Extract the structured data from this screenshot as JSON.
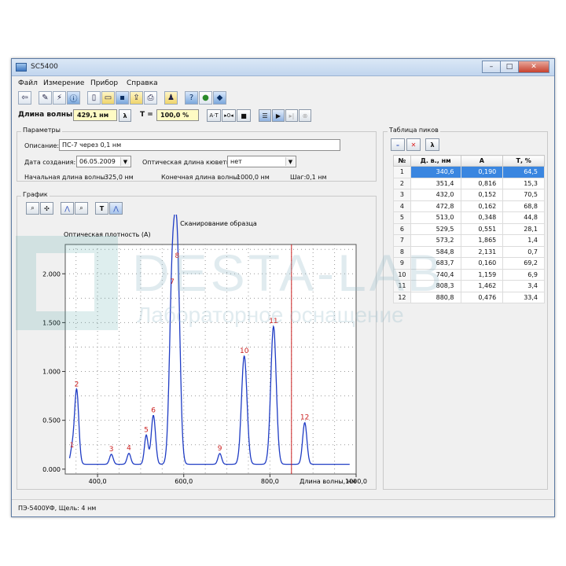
{
  "window": {
    "title": "SC5400",
    "controls": [
      "–",
      "□",
      "✕"
    ]
  },
  "menu": [
    "Файл",
    "Измерение",
    "Прибор",
    "Справка"
  ],
  "toolbar": {
    "buttons": [
      "exit-icon",
      "settings-icon",
      "calibrate-icon",
      "info-icon",
      "new-file-icon",
      "open-folder-icon",
      "save-icon",
      "save-as-icon",
      "print-icon",
      "export-icon",
      "help-icon",
      "globe-icon",
      "book-icon"
    ]
  },
  "wavelength_bar": {
    "wavelength_label": "Длина волны:",
    "wavelength_value": "429,1 нм",
    "lambda_button": "λ",
    "t_label": "T =",
    "t_value": "100,0 %",
    "at_button": "A·T",
    "zero_button": "▸0◂",
    "stop_button": "■"
  },
  "params": {
    "group_title": "Параметры",
    "description_label": "Описание:",
    "description_value": "ПС-7 через 0,1 нм",
    "date_label": "Дата создания:",
    "date_value": "06.05.2009",
    "cuvette_label": "Оптическая длина кюветы:",
    "cuvette_value": "нет",
    "start_label": "Начальная длина волны:",
    "start_value": "325,0 нм",
    "end_label": "Конечная длина волны:",
    "end_value": "1000,0 нм",
    "step_label": "Шаг:",
    "step_value": "0,1 нм"
  },
  "graph": {
    "group_title": "График",
    "tool_t": "T",
    "tool_lambda": "λ"
  },
  "chart_data": {
    "type": "line",
    "title": "Сканирование образца",
    "ylabel": "Оптическая плотность (А)",
    "xlabel": "Длина волны, нм",
    "xlim": [
      325,
      1000
    ],
    "ylim": [
      -0.05,
      2.3
    ],
    "xticks": [
      400,
      600,
      800,
      1000
    ],
    "xtick_labels": [
      "400,0",
      "600,0",
      "800,0",
      "1000,0"
    ],
    "yticks": [
      0,
      0.5,
      1.0,
      1.5,
      2.0
    ],
    "ytick_labels": [
      "0.000",
      "0.500",
      "1.000",
      "1.500",
      "2.000"
    ],
    "grid": true,
    "cursor_x": 850,
    "color": "#1f3cc4",
    "cursor_color": "#cc2222",
    "baseline": 0.05,
    "peaks": [
      {
        "n": 1,
        "x": 340.6,
        "y": 0.19
      },
      {
        "n": 2,
        "x": 351.4,
        "y": 0.816
      },
      {
        "n": 3,
        "x": 432.0,
        "y": 0.152
      },
      {
        "n": 4,
        "x": 472.8,
        "y": 0.162
      },
      {
        "n": 5,
        "x": 513.0,
        "y": 0.348
      },
      {
        "n": 6,
        "x": 529.5,
        "y": 0.551
      },
      {
        "n": 7,
        "x": 573.2,
        "y": 1.865
      },
      {
        "n": 8,
        "x": 584.8,
        "y": 2.131
      },
      {
        "n": 9,
        "x": 683.7,
        "y": 0.16
      },
      {
        "n": 10,
        "x": 740.4,
        "y": 1.159
      },
      {
        "n": 11,
        "x": 808.3,
        "y": 1.462
      },
      {
        "n": 12,
        "x": 880.8,
        "y": 0.476
      }
    ]
  },
  "peak_table": {
    "title": "Таблица пиков",
    "buttons": [
      "–",
      "✕",
      "λ"
    ],
    "headers": [
      "№",
      "Д. в., нм",
      "А",
      "Т, %"
    ],
    "selected_row": 0,
    "rows": [
      [
        "1",
        "340,6",
        "0,190",
        "64,5"
      ],
      [
        "2",
        "351,4",
        "0,816",
        "15,3"
      ],
      [
        "3",
        "432,0",
        "0,152",
        "70,5"
      ],
      [
        "4",
        "472,8",
        "0,162",
        "68,8"
      ],
      [
        "5",
        "513,0",
        "0,348",
        "44,8"
      ],
      [
        "6",
        "529,5",
        "0,551",
        "28,1"
      ],
      [
        "7",
        "573,2",
        "1,865",
        "1,4"
      ],
      [
        "8",
        "584,8",
        "2,131",
        "0,7"
      ],
      [
        "9",
        "683,7",
        "0,160",
        "69,2"
      ],
      [
        "10",
        "740,4",
        "1,159",
        "6,9"
      ],
      [
        "11",
        "808,3",
        "1,462",
        "3,4"
      ],
      [
        "12",
        "880,8",
        "0,476",
        "33,4"
      ]
    ]
  },
  "status": {
    "text": "ПЭ-5400УФ, Щель: 4 нм"
  },
  "watermark": {
    "brand": "DESTA-LAB",
    "tagline": "Лабораторное оснащение"
  }
}
